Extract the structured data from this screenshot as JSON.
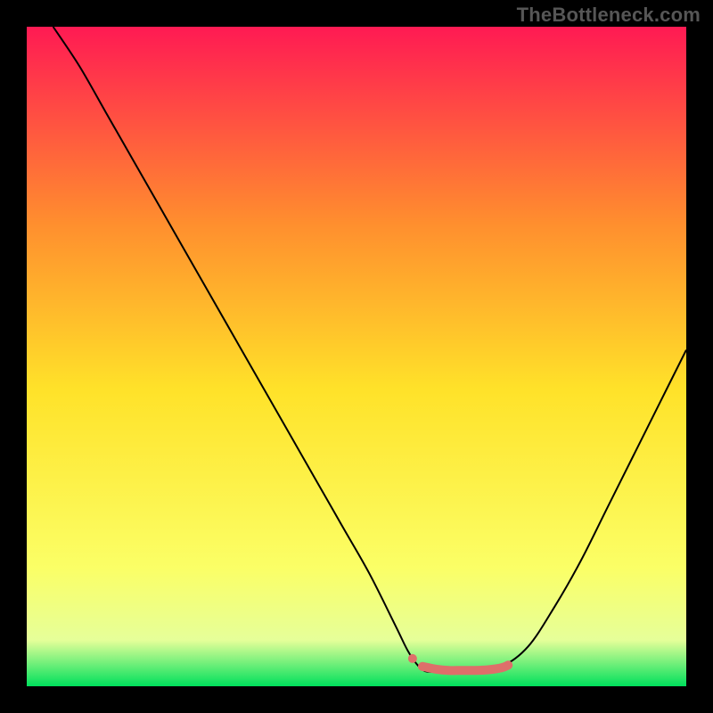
{
  "attribution": "TheBottleneck.com",
  "chart_data": {
    "type": "line",
    "title": "",
    "xlabel": "",
    "ylabel": "",
    "xlim": [
      0,
      100
    ],
    "ylim": [
      0,
      100
    ],
    "background_gradient": {
      "top": "#ff1a53",
      "mid_upper": "#ff8f2e",
      "mid": "#ffe229",
      "mid_lower": "#fbff66",
      "band": "#e6ff99",
      "bottom": "#00e05c"
    },
    "series": [
      {
        "name": "bottleneck-curve",
        "color": "#000000",
        "stroke_width": 2,
        "x": [
          4,
          8,
          12,
          16,
          20,
          24,
          28,
          32,
          36,
          40,
          44,
          48,
          52,
          56,
          58,
          60,
          62,
          64,
          66,
          68,
          72,
          76,
          80,
          84,
          88,
          92,
          96,
          100
        ],
        "y": [
          100,
          94,
          87,
          80,
          73,
          66,
          59,
          52,
          45,
          38,
          31,
          24,
          17,
          9,
          5,
          2.5,
          2.2,
          2.2,
          2.2,
          2.5,
          3,
          6,
          12,
          19,
          27,
          35,
          43,
          51
        ]
      },
      {
        "name": "highlight-segment",
        "color": "#de6f6a",
        "stroke_width": 10,
        "x": [
          60,
          62,
          64,
          66,
          68,
          70,
          72,
          73
        ],
        "y": [
          3.0,
          2.6,
          2.4,
          2.4,
          2.4,
          2.5,
          2.8,
          3.2
        ]
      }
    ],
    "markers": [
      {
        "name": "highlight-dot",
        "x": 58.5,
        "y": 4.2,
        "r": 5,
        "color": "#de6f6a"
      }
    ]
  }
}
